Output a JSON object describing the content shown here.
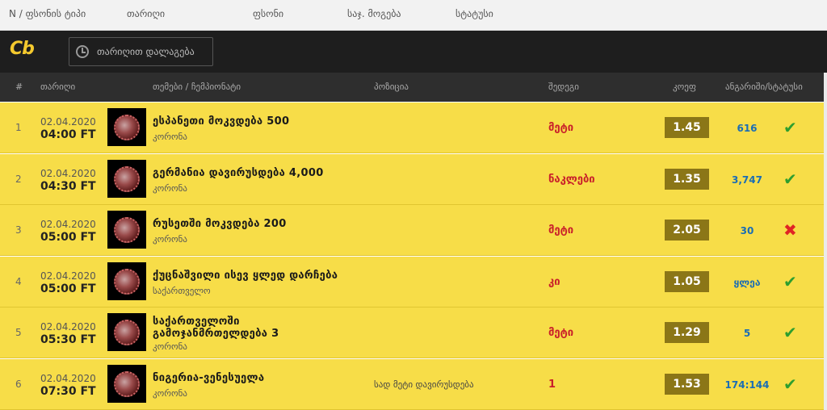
{
  "topbar": {
    "col1": "N / ფსონის ტიპი",
    "col2": "თარიღი",
    "col3": "ფსონი",
    "col4": "საჯ. მოგება",
    "col5": "სტატუსი"
  },
  "brand": {
    "logo": "Cb"
  },
  "date_filter": {
    "label": "თარიღით დალაგება"
  },
  "table": {
    "headers": {
      "num": "#",
      "date": "თარიღი",
      "event": "თემები / ჩემპიონატი",
      "position": "პოზიცია",
      "bet": "შედეგი",
      "odd": "კოეფ",
      "result": "ანგარიში/სტატუსი"
    },
    "rows": [
      {
        "num": "1",
        "date": "02.04.2020",
        "time": "04:00 FT",
        "title": "ესპანეთი მოკვდება 500",
        "sub": "კორონა",
        "pos": "",
        "bet": "მეტი",
        "odd": "1.45",
        "result": "616",
        "status": "win",
        "status_icon": "✔"
      },
      {
        "num": "2",
        "date": "02.04.2020",
        "time": "04:30 FT",
        "title": "გერმანია დავირუსდება 4,000",
        "sub": "კორონა",
        "pos": "",
        "bet": "ნაკლები",
        "odd": "1.35",
        "result": "3,747",
        "status": "win",
        "status_icon": "✔"
      },
      {
        "num": "3",
        "date": "02.04.2020",
        "time": "05:00 FT",
        "title": "რუსეთში მოკვდება 200",
        "sub": "კორონა",
        "pos": "",
        "bet": "მეტი",
        "odd": "2.05",
        "result": "30",
        "status": "lose",
        "status_icon": "✖"
      },
      {
        "num": "4",
        "date": "02.04.2020",
        "time": "05:00 FT",
        "title": "ქუცნაშვილი ისევ ყლედ დარჩება",
        "sub": "საქართველო",
        "pos": "",
        "bet": "კი",
        "odd": "1.05",
        "result": "ყლეა",
        "status": "win",
        "status_icon": "✔"
      },
      {
        "num": "5",
        "date": "02.04.2020",
        "time": "05:30 FT",
        "title": "საქართველოში",
        "title2": "გამოჯანმრთელდება 3",
        "sub": "კორონა",
        "pos": "",
        "bet": "მეტი",
        "odd": "1.29",
        "result": "5",
        "status": "win",
        "status_icon": "✔"
      },
      {
        "num": "6",
        "date": "02.04.2020",
        "time": "07:30 FT",
        "title": "ნიგერია-ვენესუელა",
        "sub": "კორონა",
        "pos": "სად მეტი დავირუსდება",
        "bet": "1",
        "odd": "1.53",
        "result": "174:144",
        "status": "win",
        "status_icon": "✔"
      }
    ]
  },
  "colors": {
    "row_bg": "#f7dd48",
    "header_bg": "#2e2e2e",
    "accent": "#f4c92e",
    "odd_bg": "#8b7617",
    "bet_red": "#c9202a",
    "result_blue": "#1a6db5",
    "win_green": "#2e9e2e",
    "lose_red": "#e02424"
  }
}
